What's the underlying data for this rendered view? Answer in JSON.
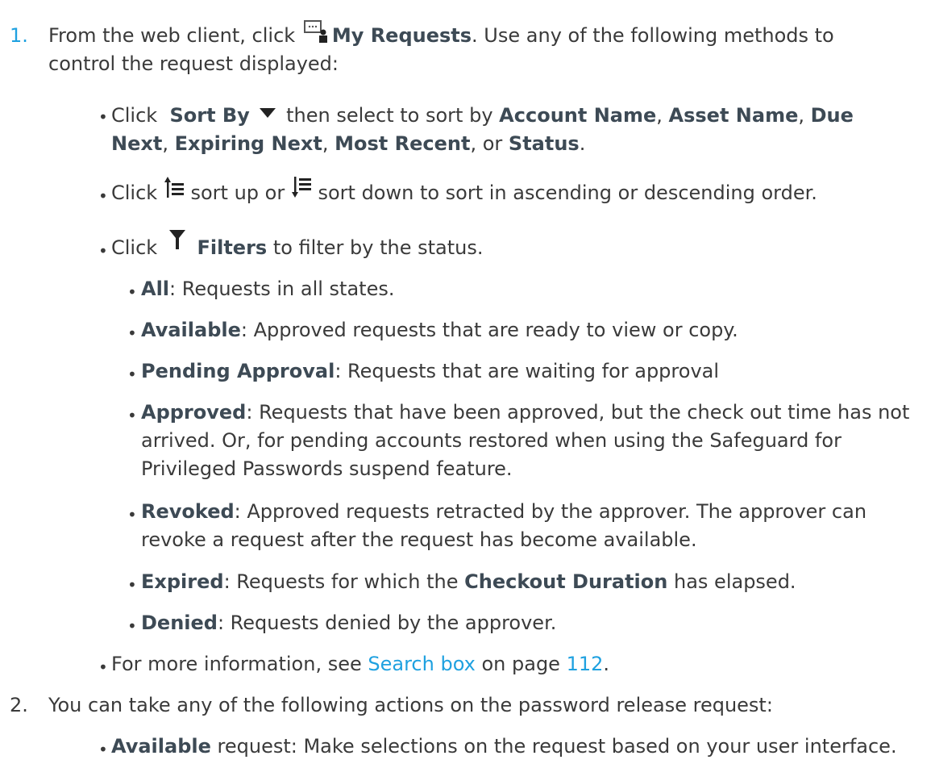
{
  "step1": {
    "number": "1.",
    "text_before_icon": "From the web client, click",
    "icon": "my-requests-icon",
    "bold": "My Requests",
    "text_after": ". Use any of the following methods to control the request displayed:",
    "bullets": {
      "sort_by": {
        "click": "Click",
        "bold": "Sort By",
        "icon": "sort-dropdown-arrow-icon",
        "middle": "then select to sort by",
        "opt1": "Account Name",
        "opt2": "Asset Name",
        "opt3": "Due Next",
        "opt4": "Expiring Next",
        "opt5": "Most Recent",
        "or": "or",
        "opt6": "Status",
        "end": "."
      },
      "sort_dir": {
        "click": "Click",
        "up_icon": "sort-up-icon",
        "up": "sort up or",
        "down_icon": "sort-down-icon",
        "down": "sort down to sort in ascending or descending order."
      },
      "filters": {
        "click": "Click",
        "icon": "filter-icon",
        "bold": "Filters",
        "rest": "to filter by the status.",
        "items": [
          {
            "term": "All",
            "desc": ": Requests in all states."
          },
          {
            "term": "Available",
            "desc": ": Approved requests that are ready to view or copy."
          },
          {
            "term": "Pending Approval",
            "desc": ": Requests that are waiting for approval"
          },
          {
            "term": "Approved",
            "desc": ": Requests that have been approved, but the check out time has not arrived. Or, for pending accounts restored when using the Safeguard for Privileged Passwords suspend feature."
          },
          {
            "term": "Revoked",
            "desc": ": Approved requests retracted by the approver. The approver can revoke a request after the request has become available."
          },
          {
            "term": "Expired",
            "desc_a": ": Requests for which the",
            "bold": "Checkout Duration",
            "desc_b": "has elapsed."
          },
          {
            "term": "Denied",
            "desc": ": Requests denied by the approver."
          }
        ]
      },
      "more_info": {
        "before": "For more information, see",
        "link": "Search box",
        "middle": "on page",
        "page": "112",
        "end": "."
      }
    }
  },
  "step2": {
    "number": "2.",
    "text": "You can take any of the following actions on the password release request:",
    "bullets": [
      {
        "term": "Available",
        "desc": "request: Make selections on the request based on your user interface."
      }
    ]
  }
}
